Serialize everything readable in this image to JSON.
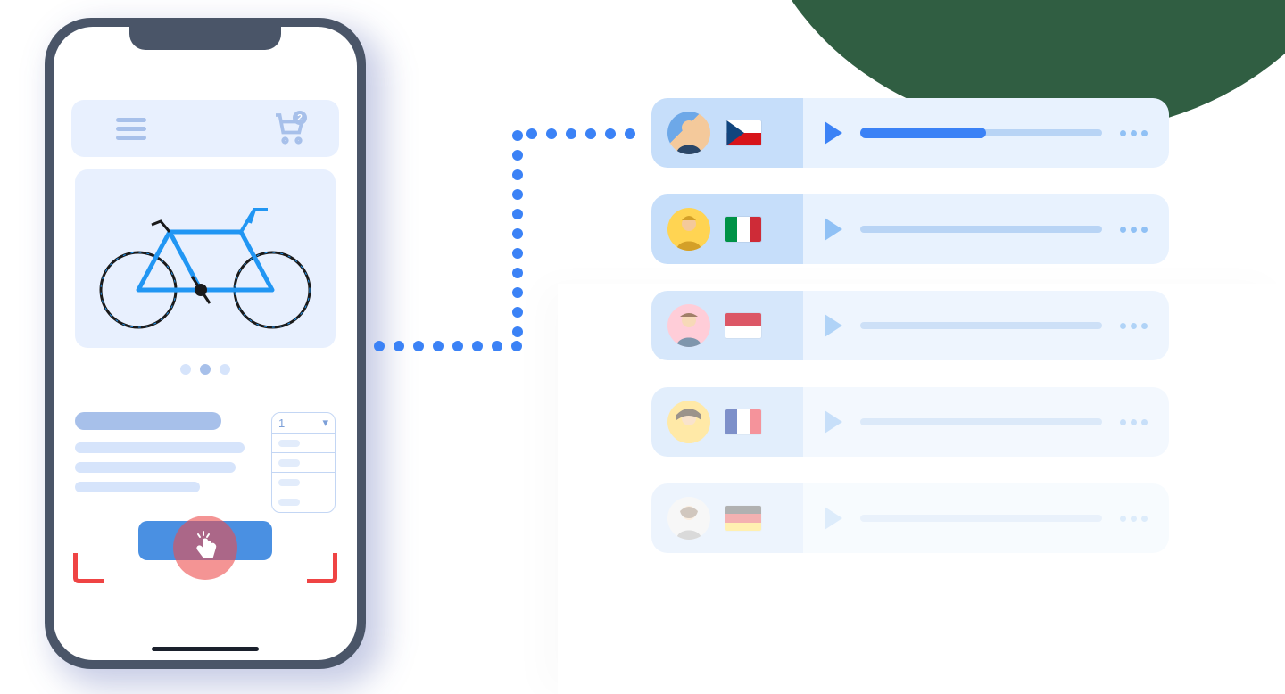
{
  "phone": {
    "cart_count": "2",
    "quantity_selected": "1",
    "carousel_active_index": 1,
    "cta_action": "tap",
    "recording": true
  },
  "testers": [
    {
      "country": "Czechia",
      "flag": "czech",
      "active": true
    },
    {
      "country": "Italy",
      "flag": "italy",
      "active": false
    },
    {
      "country": "Indonesia",
      "flag": "indonesia",
      "active": false
    },
    {
      "country": "France",
      "flag": "france",
      "active": false
    },
    {
      "country": "Germany",
      "flag": "germany",
      "active": false
    }
  ]
}
